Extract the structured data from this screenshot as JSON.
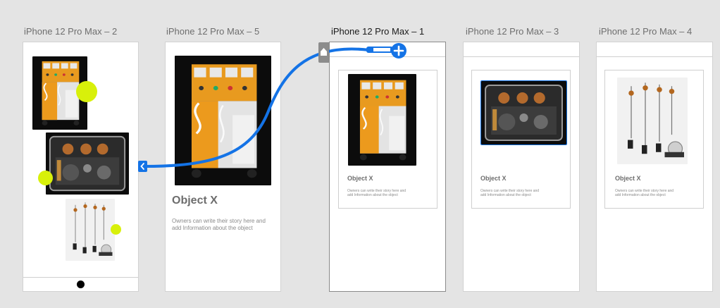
{
  "artboards": [
    {
      "id": "ab2",
      "title": "iPhone 12 Pro Max – 2"
    },
    {
      "id": "ab5",
      "title": "iPhone 12 Pro Max – 5"
    },
    {
      "id": "ab1",
      "title": "iPhone 12 Pro Max – 1"
    },
    {
      "id": "ab3",
      "title": "iPhone 12 Pro Max – 3"
    },
    {
      "id": "ab4",
      "title": "iPhone 12 Pro Max – 4"
    }
  ],
  "object_title": "Object X",
  "object_body": "Owners can write their story here and add Information about the object",
  "colors": {
    "accent": "#1473e6",
    "lime": "#d8f00a",
    "canvas": "#e4e4e4"
  },
  "icons": {
    "add": "plus-circle-icon",
    "back": "chevron-left-icon",
    "home": "home-icon"
  }
}
